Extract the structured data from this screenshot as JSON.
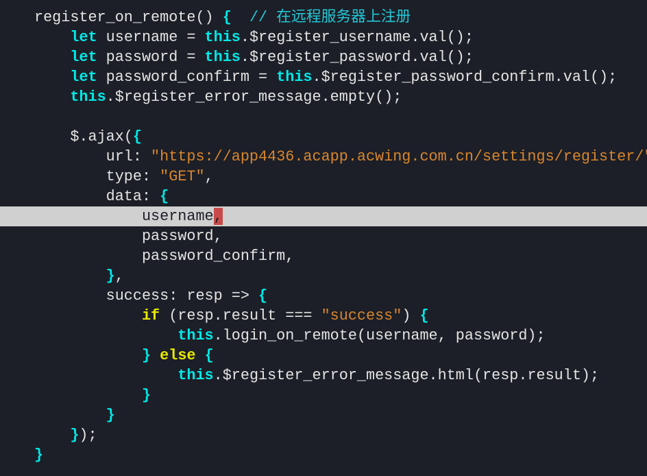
{
  "colors": {
    "background": "#1c1f27",
    "keyword": "#00e8e8",
    "string": "#d8862e",
    "control": "#e8e800",
    "cursor": "#c94a4a",
    "cursorline": "#d0d0d0"
  },
  "cursor_line": 10,
  "lines": [
    [
      {
        "t": "register_on_remote() "
      },
      {
        "t": "{",
        "c": "br"
      },
      {
        "t": "  // 在远程服务器上注册",
        "c": "cm"
      }
    ],
    [
      {
        "t": "    "
      },
      {
        "t": "let",
        "c": "kw"
      },
      {
        "t": " username = "
      },
      {
        "t": "this",
        "c": "kw"
      },
      {
        "t": ".$register_username.val();"
      }
    ],
    [
      {
        "t": "    "
      },
      {
        "t": "let",
        "c": "kw"
      },
      {
        "t": " password = "
      },
      {
        "t": "this",
        "c": "kw"
      },
      {
        "t": ".$register_password.val();"
      }
    ],
    [
      {
        "t": "    "
      },
      {
        "t": "let",
        "c": "kw"
      },
      {
        "t": " password_confirm = "
      },
      {
        "t": "this",
        "c": "kw"
      },
      {
        "t": ".$register_password_confirm.val();"
      }
    ],
    [
      {
        "t": "    "
      },
      {
        "t": "this",
        "c": "kw"
      },
      {
        "t": ".$register_error_message.empty();"
      }
    ],
    [],
    [
      {
        "t": "    $.ajax("
      },
      {
        "t": "{",
        "c": "br"
      }
    ],
    [
      {
        "t": "        url: "
      },
      {
        "t": "\"https://app4436.acapp.acwing.com.cn/settings/register/\"",
        "c": "st"
      }
    ],
    [
      {
        "t": "        type: "
      },
      {
        "t": "\"GET\"",
        "c": "st"
      },
      {
        "t": ","
      }
    ],
    [
      {
        "t": "        data: "
      },
      {
        "t": "{",
        "c": "br"
      }
    ],
    [
      {
        "t": "            username"
      },
      {
        "t": ",",
        "c": "cur"
      }
    ],
    [
      {
        "t": "            password,"
      }
    ],
    [
      {
        "t": "            password_confirm,"
      }
    ],
    [
      {
        "t": "        "
      },
      {
        "t": "}",
        "c": "br"
      },
      {
        "t": ","
      }
    ],
    [
      {
        "t": "        success: resp => "
      },
      {
        "t": "{",
        "c": "br"
      }
    ],
    [
      {
        "t": "            "
      },
      {
        "t": "if",
        "c": "ctl"
      },
      {
        "t": " (resp.result === "
      },
      {
        "t": "\"success\"",
        "c": "st"
      },
      {
        "t": ") "
      },
      {
        "t": "{",
        "c": "br"
      }
    ],
    [
      {
        "t": "                "
      },
      {
        "t": "this",
        "c": "kw"
      },
      {
        "t": ".login_on_remote(username, password);"
      }
    ],
    [
      {
        "t": "            "
      },
      {
        "t": "}",
        "c": "br"
      },
      {
        "t": " "
      },
      {
        "t": "else",
        "c": "ctl"
      },
      {
        "t": " "
      },
      {
        "t": "{",
        "c": "br"
      }
    ],
    [
      {
        "t": "                "
      },
      {
        "t": "this",
        "c": "kw"
      },
      {
        "t": ".$register_error_message.html(resp.result);"
      }
    ],
    [
      {
        "t": "            "
      },
      {
        "t": "}",
        "c": "br"
      }
    ],
    [
      {
        "t": "        "
      },
      {
        "t": "}",
        "c": "br"
      }
    ],
    [
      {
        "t": "    "
      },
      {
        "t": "}",
        "c": "br"
      },
      {
        "t": ");"
      }
    ],
    [
      {
        "t": "}",
        "c": "br"
      }
    ]
  ]
}
